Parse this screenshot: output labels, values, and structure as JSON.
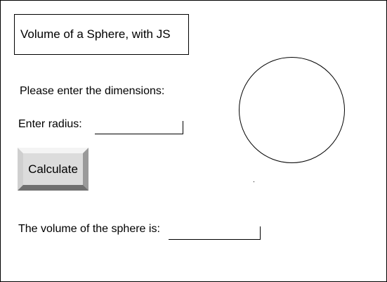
{
  "title": "Volume of a Sphere, with JS",
  "prompt": "Please enter the dimensions:",
  "radius": {
    "label": "Enter radius:",
    "value": "",
    "placeholder": ""
  },
  "calculate_label": "Calculate",
  "result": {
    "label": "The volume of the sphere is:",
    "value": ""
  }
}
